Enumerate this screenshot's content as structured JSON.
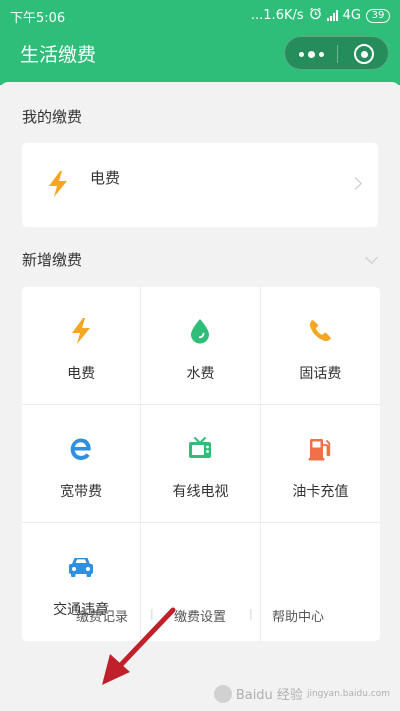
{
  "status_bar": {
    "time": "下午5:06",
    "speed": "...1.6K/s",
    "network": "4G",
    "battery": "39"
  },
  "header": {
    "title": "生活缴费"
  },
  "my_payments": {
    "title": "我的缴费",
    "items": [
      {
        "label": "电费",
        "icon": "lightning-icon"
      }
    ]
  },
  "new_payments": {
    "title": "新增缴费",
    "items": [
      {
        "label": "电费",
        "icon": "lightning-icon"
      },
      {
        "label": "水费",
        "icon": "water-drop-icon"
      },
      {
        "label": "固话费",
        "icon": "phone-icon"
      },
      {
        "label": "宽带费",
        "icon": "broadband-e-icon"
      },
      {
        "label": "有线电视",
        "icon": "tv-icon"
      },
      {
        "label": "油卡充值",
        "icon": "fuel-pump-icon"
      },
      {
        "label": "交通违章",
        "icon": "car-icon"
      }
    ]
  },
  "footer": {
    "links": [
      "缴费记录",
      "缴费设置",
      "帮助中心"
    ]
  },
  "colors": {
    "header_bg": "#2fbd7a",
    "lightning": "#f5a623",
    "water": "#2fbd7a",
    "phone": "#f5a623",
    "broadband": "#2f8fe0",
    "tv": "#2fbd7a",
    "fuel": "#f07048",
    "car": "#2f8fe0",
    "annotation_arrow": "#c0202a"
  },
  "watermark": {
    "text": "Baidu 经验",
    "sub": "jingyan.baidu.com"
  }
}
